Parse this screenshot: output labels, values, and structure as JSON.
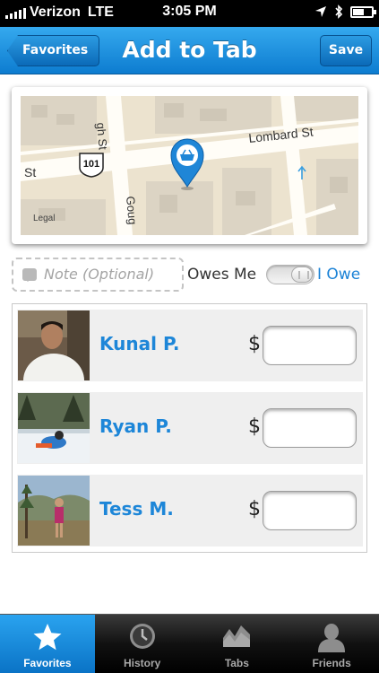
{
  "status_bar": {
    "carrier": "Verizon",
    "network": "LTE",
    "time": "3:05 PM"
  },
  "nav": {
    "back_label": "Favorites",
    "title": "Add to Tab",
    "save_label": "Save"
  },
  "map": {
    "legal": "Legal",
    "street_labels": {
      "lombard": "Lombard St",
      "st_left": "St",
      "gough": "Goug",
      "cross": "gh St",
      "route": "101"
    },
    "pin_icon": "basket-icon"
  },
  "note": {
    "placeholder": "Note (Optional)",
    "icon": "note-icon"
  },
  "toggle": {
    "left_label": "Owes Me",
    "right_label": "I Owe"
  },
  "currency_symbol": "$",
  "friends": [
    {
      "name": "Kunal P.",
      "amount": ""
    },
    {
      "name": "Ryan P.",
      "amount": ""
    },
    {
      "name": "Tess M.",
      "amount": ""
    }
  ],
  "tabs": [
    {
      "label": "Favorites",
      "icon": "star-icon",
      "active": true
    },
    {
      "label": "History",
      "icon": "clock-icon",
      "active": false
    },
    {
      "label": "Tabs",
      "icon": "chart-icon",
      "active": false
    },
    {
      "label": "Friends",
      "icon": "person-icon",
      "active": false
    }
  ],
  "colors": {
    "accent": "#1a82d6",
    "nav_bar": "#0d7cd0",
    "name_text": "#1d86d8"
  }
}
